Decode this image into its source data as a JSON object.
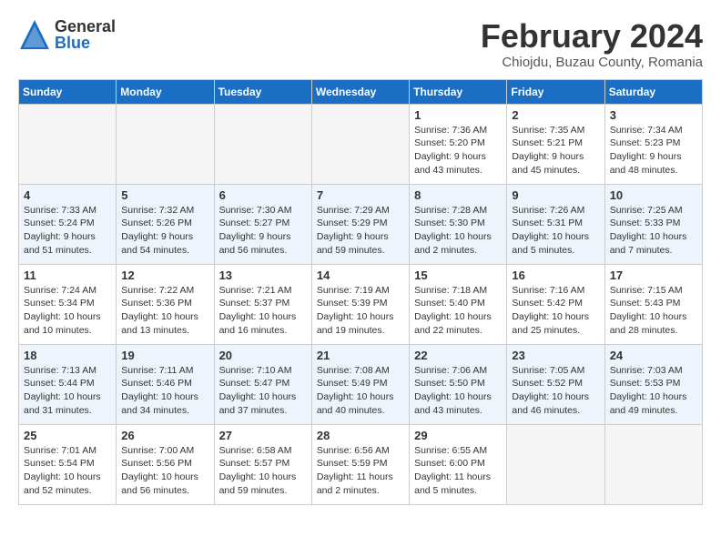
{
  "header": {
    "logo_general": "General",
    "logo_blue": "Blue",
    "month_title": "February 2024",
    "location": "Chiojdu, Buzau County, Romania"
  },
  "days_of_week": [
    "Sunday",
    "Monday",
    "Tuesday",
    "Wednesday",
    "Thursday",
    "Friday",
    "Saturday"
  ],
  "weeks": [
    [
      {
        "day": "",
        "info": ""
      },
      {
        "day": "",
        "info": ""
      },
      {
        "day": "",
        "info": ""
      },
      {
        "day": "",
        "info": ""
      },
      {
        "day": "1",
        "info": "Sunrise: 7:36 AM\nSunset: 5:20 PM\nDaylight: 9 hours\nand 43 minutes."
      },
      {
        "day": "2",
        "info": "Sunrise: 7:35 AM\nSunset: 5:21 PM\nDaylight: 9 hours\nand 45 minutes."
      },
      {
        "day": "3",
        "info": "Sunrise: 7:34 AM\nSunset: 5:23 PM\nDaylight: 9 hours\nand 48 minutes."
      }
    ],
    [
      {
        "day": "4",
        "info": "Sunrise: 7:33 AM\nSunset: 5:24 PM\nDaylight: 9 hours\nand 51 minutes."
      },
      {
        "day": "5",
        "info": "Sunrise: 7:32 AM\nSunset: 5:26 PM\nDaylight: 9 hours\nand 54 minutes."
      },
      {
        "day": "6",
        "info": "Sunrise: 7:30 AM\nSunset: 5:27 PM\nDaylight: 9 hours\nand 56 minutes."
      },
      {
        "day": "7",
        "info": "Sunrise: 7:29 AM\nSunset: 5:29 PM\nDaylight: 9 hours\nand 59 minutes."
      },
      {
        "day": "8",
        "info": "Sunrise: 7:28 AM\nSunset: 5:30 PM\nDaylight: 10 hours\nand 2 minutes."
      },
      {
        "day": "9",
        "info": "Sunrise: 7:26 AM\nSunset: 5:31 PM\nDaylight: 10 hours\nand 5 minutes."
      },
      {
        "day": "10",
        "info": "Sunrise: 7:25 AM\nSunset: 5:33 PM\nDaylight: 10 hours\nand 7 minutes."
      }
    ],
    [
      {
        "day": "11",
        "info": "Sunrise: 7:24 AM\nSunset: 5:34 PM\nDaylight: 10 hours\nand 10 minutes."
      },
      {
        "day": "12",
        "info": "Sunrise: 7:22 AM\nSunset: 5:36 PM\nDaylight: 10 hours\nand 13 minutes."
      },
      {
        "day": "13",
        "info": "Sunrise: 7:21 AM\nSunset: 5:37 PM\nDaylight: 10 hours\nand 16 minutes."
      },
      {
        "day": "14",
        "info": "Sunrise: 7:19 AM\nSunset: 5:39 PM\nDaylight: 10 hours\nand 19 minutes."
      },
      {
        "day": "15",
        "info": "Sunrise: 7:18 AM\nSunset: 5:40 PM\nDaylight: 10 hours\nand 22 minutes."
      },
      {
        "day": "16",
        "info": "Sunrise: 7:16 AM\nSunset: 5:42 PM\nDaylight: 10 hours\nand 25 minutes."
      },
      {
        "day": "17",
        "info": "Sunrise: 7:15 AM\nSunset: 5:43 PM\nDaylight: 10 hours\nand 28 minutes."
      }
    ],
    [
      {
        "day": "18",
        "info": "Sunrise: 7:13 AM\nSunset: 5:44 PM\nDaylight: 10 hours\nand 31 minutes."
      },
      {
        "day": "19",
        "info": "Sunrise: 7:11 AM\nSunset: 5:46 PM\nDaylight: 10 hours\nand 34 minutes."
      },
      {
        "day": "20",
        "info": "Sunrise: 7:10 AM\nSunset: 5:47 PM\nDaylight: 10 hours\nand 37 minutes."
      },
      {
        "day": "21",
        "info": "Sunrise: 7:08 AM\nSunset: 5:49 PM\nDaylight: 10 hours\nand 40 minutes."
      },
      {
        "day": "22",
        "info": "Sunrise: 7:06 AM\nSunset: 5:50 PM\nDaylight: 10 hours\nand 43 minutes."
      },
      {
        "day": "23",
        "info": "Sunrise: 7:05 AM\nSunset: 5:52 PM\nDaylight: 10 hours\nand 46 minutes."
      },
      {
        "day": "24",
        "info": "Sunrise: 7:03 AM\nSunset: 5:53 PM\nDaylight: 10 hours\nand 49 minutes."
      }
    ],
    [
      {
        "day": "25",
        "info": "Sunrise: 7:01 AM\nSunset: 5:54 PM\nDaylight: 10 hours\nand 52 minutes."
      },
      {
        "day": "26",
        "info": "Sunrise: 7:00 AM\nSunset: 5:56 PM\nDaylight: 10 hours\nand 56 minutes."
      },
      {
        "day": "27",
        "info": "Sunrise: 6:58 AM\nSunset: 5:57 PM\nDaylight: 10 hours\nand 59 minutes."
      },
      {
        "day": "28",
        "info": "Sunrise: 6:56 AM\nSunset: 5:59 PM\nDaylight: 11 hours\nand 2 minutes."
      },
      {
        "day": "29",
        "info": "Sunrise: 6:55 AM\nSunset: 6:00 PM\nDaylight: 11 hours\nand 5 minutes."
      },
      {
        "day": "",
        "info": ""
      },
      {
        "day": "",
        "info": ""
      }
    ]
  ]
}
